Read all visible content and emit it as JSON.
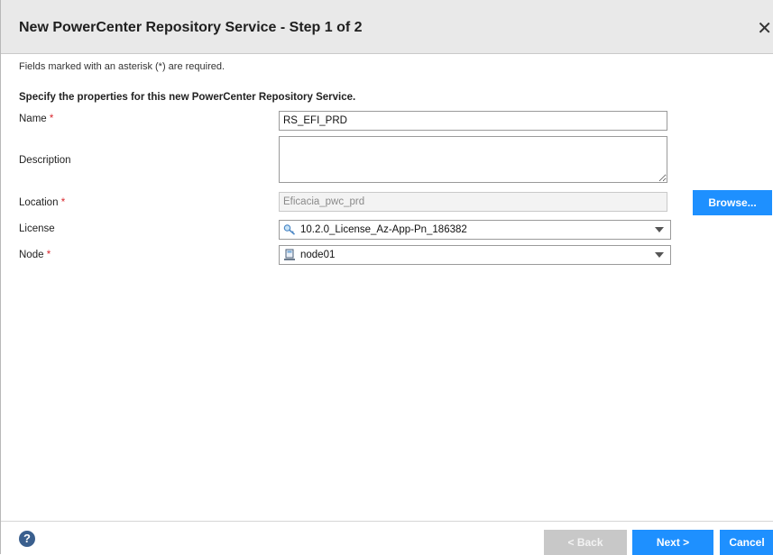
{
  "dialog": {
    "title": "New PowerCenter Repository Service - Step 1 of 2",
    "close_glyph": "✕",
    "required_note": "Fields marked with an asterisk (*) are required.",
    "intro": "Specify the properties for this new PowerCenter Repository Service."
  },
  "form": {
    "name": {
      "label": "Name",
      "required_mark": "*",
      "value": "RS_EFI_PRD"
    },
    "description": {
      "label": "Description",
      "value": ""
    },
    "location": {
      "label": "Location",
      "required_mark": "*",
      "value": "Eficacia_pwc_prd"
    },
    "license": {
      "label": "License",
      "value": "10.2.0_License_Az-App-Pn_186382",
      "icon": "key-icon"
    },
    "node": {
      "label": "Node",
      "required_mark": "*",
      "value": "node01",
      "icon": "node-computer-icon"
    }
  },
  "buttons": {
    "browse": "Browse...",
    "back": "< Back",
    "next": "Next >",
    "cancel": "Cancel"
  },
  "help": {
    "glyph": "?"
  },
  "colors": {
    "accent": "#1e90ff",
    "required": "#d9272e",
    "disabled": "#c8c8c8",
    "titlebar": "#e9e9e9"
  }
}
